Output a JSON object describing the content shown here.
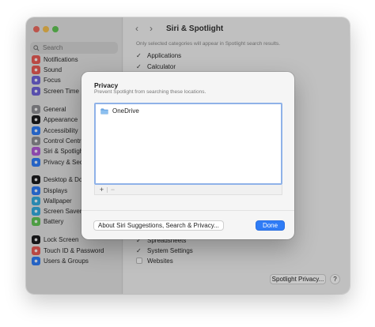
{
  "window": {
    "traffic_lights": [
      "#ec6a5e",
      "#f4bf4f",
      "#61c554"
    ]
  },
  "sidebar": {
    "search_placeholder": "Search",
    "items": [
      {
        "label": "Notifications",
        "icon": "bell-icon",
        "color": "#e85a55"
      },
      {
        "label": "Sound",
        "icon": "speaker-icon",
        "color": "#e85a55"
      },
      {
        "label": "Focus",
        "icon": "moon-icon",
        "color": "#6f63d8"
      },
      {
        "label": "Screen Time",
        "icon": "hourglass-icon",
        "color": "#6f63d8"
      },
      {
        "label": "General",
        "icon": "gear-icon",
        "color": "#8e8e93"
      },
      {
        "label": "Appearance",
        "icon": "appearance-icon",
        "color": "#1c1c1e"
      },
      {
        "label": "Accessibility",
        "icon": "accessibility-icon",
        "color": "#2f7cf6"
      },
      {
        "label": "Control Centre",
        "icon": "control-centre-icon",
        "color": "#8e8e93"
      },
      {
        "label": "Siri & Spotlight",
        "icon": "siri-icon",
        "color": "#b05ad6"
      },
      {
        "label": "Privacy & Security",
        "icon": "hand-icon",
        "color": "#2f7cf6"
      },
      {
        "label": "Desktop & Dock",
        "icon": "dock-icon",
        "color": "#1c1c1e"
      },
      {
        "label": "Displays",
        "icon": "display-icon",
        "color": "#2f7cf6"
      },
      {
        "label": "Wallpaper",
        "icon": "wallpaper-icon",
        "color": "#34aadc"
      },
      {
        "label": "Screen Saver",
        "icon": "screensaver-icon",
        "color": "#34aadc"
      },
      {
        "label": "Battery",
        "icon": "battery-icon",
        "color": "#61c554"
      },
      {
        "label": "Lock Screen",
        "icon": "lock-icon",
        "color": "#1c1c1e"
      },
      {
        "label": "Touch ID & Password",
        "icon": "fingerprint-icon",
        "color": "#e85a55"
      },
      {
        "label": "Users & Groups",
        "icon": "users-icon",
        "color": "#2f7cf6"
      }
    ]
  },
  "main": {
    "title": "Siri & Spotlight",
    "caption": "Only selected categories will appear in Spotlight search results.",
    "rows_top": [
      {
        "label": "Applications",
        "checked": true
      },
      {
        "label": "Calculator",
        "checked": true
      }
    ],
    "rows_bottom": [
      {
        "label": "Spreadsheets",
        "checked": true
      },
      {
        "label": "System Settings",
        "checked": true
      },
      {
        "label": "Websites",
        "checked": false
      }
    ],
    "privacy_button": "Spotlight Privacy...",
    "help_button": "?"
  },
  "dialog": {
    "title": "Privacy",
    "subtitle": "Prevent Spotlight from searching these locations.",
    "items": [
      {
        "label": "OneDrive",
        "icon": "folder-icon"
      }
    ],
    "add_label": "+",
    "remove_label": "−",
    "about_button": "About Siri Suggestions, Search & Privacy...",
    "done_button": "Done",
    "accent": "#2f7cf6"
  }
}
